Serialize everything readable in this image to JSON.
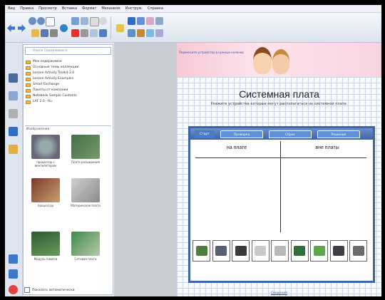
{
  "menu": {
    "items": [
      "Вид",
      "Правка",
      "Просмотр",
      "Вставка",
      "Формат",
      "Механизм",
      "Инструм.",
      "Справка"
    ]
  },
  "browser": {
    "search_placeholder": "Поиск Содержимого",
    "tree": [
      "Мое содержимое",
      "Основные темы коллекции",
      "Lesson Activity Toolkit 2.0",
      "Lesson Activity Examples",
      "Smart Exchange",
      "Пакеты от компании",
      "Notebook Sample Contents",
      "LAT 2.0 - Ru"
    ],
    "gallery_title": "Изображения",
    "gallery": [
      {
        "caption": "процессор с вентилятором"
      },
      {
        "caption": "Плата расширения"
      },
      {
        "caption": "процессор"
      },
      {
        "caption": "Материнская плата"
      },
      {
        "caption": "Модуль памяти"
      },
      {
        "caption": "Сетевая плата"
      }
    ],
    "show_all_label": "Показать автоматически"
  },
  "page": {
    "banner_link": "Перенесите устройства в нужные колонки",
    "title": "Системная плата",
    "subtitle": "Укажите устройства которые могут располагаться на системной плате.",
    "activity": {
      "tabs": [
        "Старт",
        "Проверка",
        "Сброс",
        "Решение"
      ],
      "col_left": "на плате",
      "col_right": "вне платы",
      "parts": [
        {
          "color": "#4f7d3f"
        },
        {
          "color": "#556070"
        },
        {
          "color": "#3a3a3a"
        },
        {
          "color": "#c9c9c9"
        },
        {
          "color": "#b8b8b8"
        },
        {
          "color": "#2f6f3a"
        },
        {
          "color": "#5aa84a"
        },
        {
          "color": "#3c3f48"
        },
        {
          "color": "#6b6b6b"
        }
      ]
    },
    "footer_link": "Сведения"
  },
  "colors": {
    "accent": "#3d63a8",
    "banner": "#f7c9d7"
  }
}
